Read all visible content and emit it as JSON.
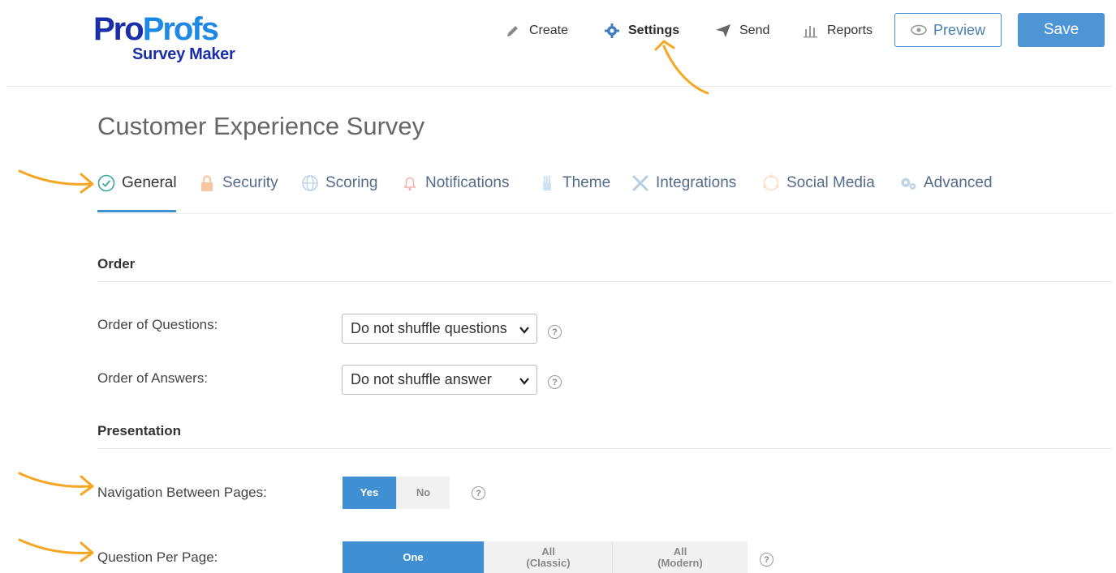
{
  "logo": {
    "part1": "Pro",
    "part2": "Profs",
    "subtitle": "Survey Maker"
  },
  "nav": {
    "create": "Create",
    "settings": "Settings",
    "send": "Send",
    "reports": "Reports",
    "preview": "Preview",
    "save": "Save"
  },
  "page_title": "Customer Experience Survey",
  "tabs": [
    {
      "label": "General",
      "icon": "check-circle-icon",
      "active": true
    },
    {
      "label": "Security",
      "icon": "lock-icon"
    },
    {
      "label": "Scoring",
      "icon": "globe-icon"
    },
    {
      "label": "Notifications",
      "icon": "bell-icon"
    },
    {
      "label": "Theme",
      "icon": "brush-icon"
    },
    {
      "label": "Integrations",
      "icon": "tools-icon"
    },
    {
      "label": "Social Media",
      "icon": "share-icon"
    },
    {
      "label": "Advanced",
      "icon": "gears-icon"
    }
  ],
  "order": {
    "heading": "Order",
    "questions_label": "Order of Questions:",
    "questions_value": "Do not shuffle questions",
    "answers_label": "Order of Answers:",
    "answers_value": "Do not shuffle answer"
  },
  "presentation": {
    "heading": "Presentation",
    "navigation_label": "Navigation Between Pages:",
    "navigation_yes": "Yes",
    "navigation_no": "No",
    "navigation_selected": "Yes",
    "qpp_label": "Question Per Page:",
    "qpp_one": "One",
    "qpp_all_classic_1": "All",
    "qpp_all_classic_2": "(Classic)",
    "qpp_all_modern_1": "All",
    "qpp_all_modern_2": "(Modern)",
    "qpp_selected": "One"
  },
  "colors": {
    "accent": "#3f8fd2",
    "arrow": "#f5a623",
    "brand_dark": "#1a2ea8",
    "brand_light": "#1e88e5"
  }
}
